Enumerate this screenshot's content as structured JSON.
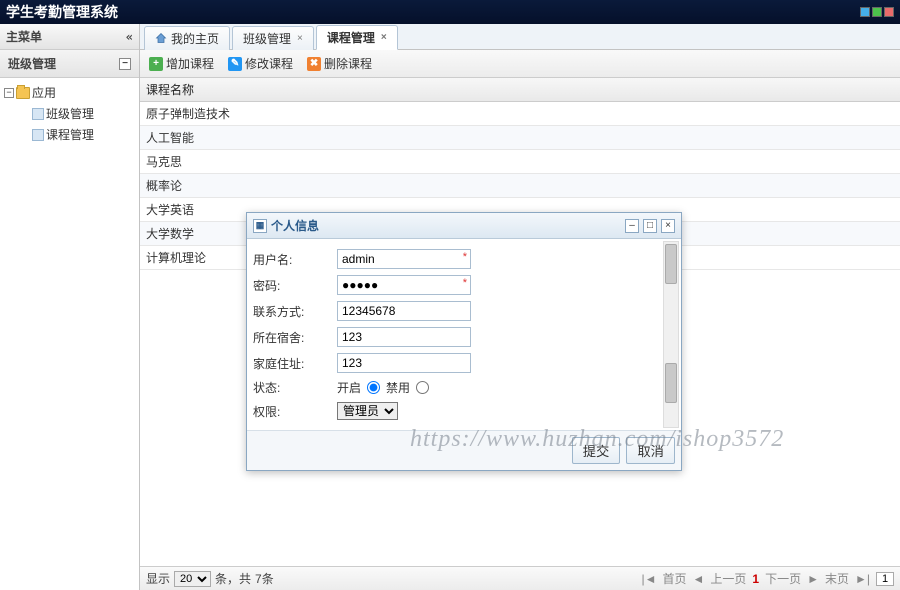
{
  "header": {
    "title": "学生考勤管理系统"
  },
  "sidebar": {
    "menuTitle": "主菜单",
    "accordion": "班级管理",
    "tree": {
      "root": "应用",
      "items": [
        "班级管理",
        "课程管理"
      ]
    }
  },
  "tabs": [
    {
      "label": "我的主页",
      "closable": false,
      "active": false,
      "home": true
    },
    {
      "label": "班级管理",
      "closable": true,
      "active": false
    },
    {
      "label": "课程管理",
      "closable": true,
      "active": true
    }
  ],
  "toolbar": {
    "add": "增加课程",
    "edit": "修改课程",
    "del": "删除课程"
  },
  "grid": {
    "header": "课程名称",
    "rows": [
      "原子弹制造技术",
      "人工智能",
      "马克思",
      "概率论",
      "大学英语",
      "大学数学",
      "计算机理论"
    ]
  },
  "dialog": {
    "title": "个人信息",
    "fields": {
      "username": {
        "label": "用户名:",
        "value": "admin"
      },
      "password": {
        "label": "密码:",
        "value": "●●●●●"
      },
      "contact": {
        "label": "联系方式:",
        "value": "12345678"
      },
      "dorm": {
        "label": "所在宿舍:",
        "value": "123"
      },
      "address": {
        "label": "家庭住址:",
        "value": "123"
      },
      "status": {
        "label": "状态:",
        "open": "开启",
        "close": "禁用"
      },
      "role": {
        "label": "权限:",
        "value": "管理员"
      }
    },
    "buttons": {
      "submit": "提交",
      "cancel": "取消"
    }
  },
  "status": {
    "showLabel": "显示",
    "pageSize": "20",
    "totalTpl1": "条，共",
    "totalTpl2": "7条",
    "pager": {
      "first": "首页",
      "prev": "上一页",
      "cur": "1",
      "next": "下一页",
      "last": "末页",
      "input": "1"
    }
  },
  "watermark": "https://www.huzhan.com/ishop3572"
}
